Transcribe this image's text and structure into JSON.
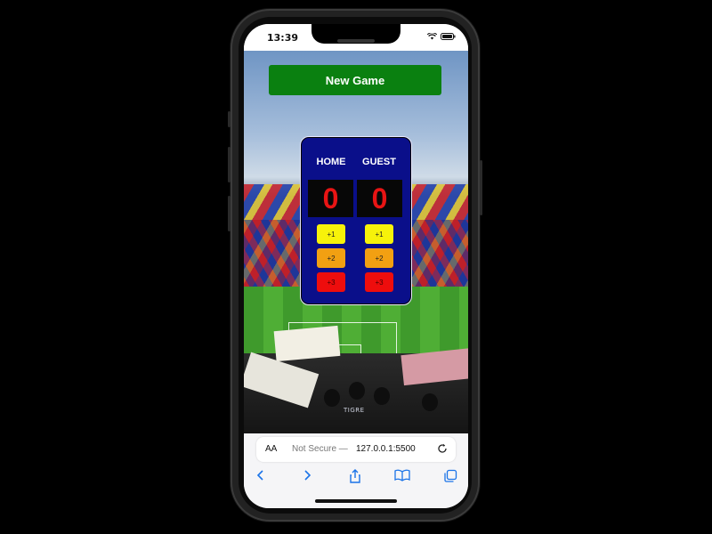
{
  "status": {
    "time": "13:39"
  },
  "app": {
    "new_game_label": "New Game",
    "home_label": "HOME",
    "guest_label": "GUEST",
    "home_score": "0",
    "guest_score": "0",
    "buttons": [
      "+1",
      "+2",
      "+3"
    ],
    "button_colors": {
      "plus1": "#f7f20a",
      "plus2": "#f2a012",
      "plus3": "#ee0d0d"
    },
    "scoreboard_color": "#0a0f8a",
    "new_game_color": "#0a8010",
    "score_color": "#e81414"
  },
  "background": {
    "banner_text": "TIGRE"
  },
  "browser": {
    "aa_label": "AA",
    "security_label": "Not Secure —",
    "url": "127.0.0.1:5500",
    "icons": [
      "back-icon",
      "forward-icon",
      "share-icon",
      "bookmarks-icon",
      "tabs-icon"
    ]
  }
}
